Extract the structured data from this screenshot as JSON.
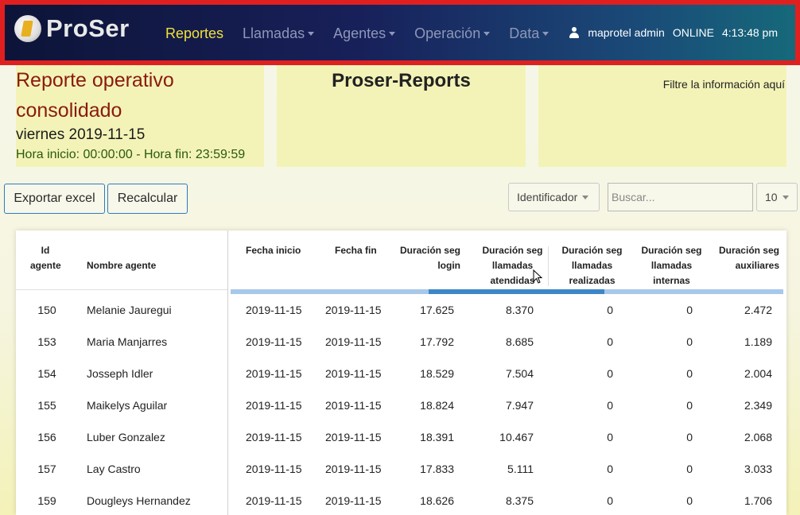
{
  "navbar": {
    "brand": "ProSer",
    "items": [
      {
        "label": "Reportes",
        "active": true,
        "dropdown": false
      },
      {
        "label": "Llamadas",
        "active": false,
        "dropdown": true
      },
      {
        "label": "Agentes",
        "active": false,
        "dropdown": true
      },
      {
        "label": "Operación",
        "active": false,
        "dropdown": true
      },
      {
        "label": "Data",
        "active": false,
        "dropdown": true
      }
    ],
    "user": "maprotel admin",
    "status": "ONLINE",
    "time": "4:13:48 pm"
  },
  "report": {
    "title": "Reporte operativo consolidado",
    "date": "viernes 2019-11-15",
    "hours": "Hora inicio: 00:00:00 - Hora fin: 23:59:59",
    "center_title": "Proser-Reports",
    "filter_hint": "Filtre la información aquí"
  },
  "toolbar": {
    "export_label": "Exportar excel",
    "recalc_label": "Recalcular",
    "field_select": "Identificador",
    "search_placeholder": "Buscar...",
    "page_size": "10"
  },
  "table": {
    "headers": [
      "Id agente",
      "Nombre agente",
      "Fecha inicio",
      "Fecha fin",
      "Duración seg login",
      "Duración seg llamadas atendidas",
      "Duración seg llamadas realizadas",
      "Duración seg llamadas internas",
      "Duración seg auxiliares"
    ],
    "rows": [
      [
        "150",
        "Melanie Jauregui",
        "2019-11-15",
        "2019-11-15",
        "17.625",
        "8.370",
        "0",
        "0",
        "2.472"
      ],
      [
        "153",
        "Maria Manjarres",
        "2019-11-15",
        "2019-11-15",
        "17.792",
        "8.685",
        "0",
        "0",
        "1.189"
      ],
      [
        "154",
        "Josseph Idler",
        "2019-11-15",
        "2019-11-15",
        "18.529",
        "7.504",
        "0",
        "0",
        "2.004"
      ],
      [
        "155",
        "Maikelys Aguilar",
        "2019-11-15",
        "2019-11-15",
        "18.824",
        "7.947",
        "0",
        "0",
        "2.349"
      ],
      [
        "156",
        "Luber Gonzalez",
        "2019-11-15",
        "2019-11-15",
        "18.391",
        "10.467",
        "0",
        "0",
        "2.068"
      ],
      [
        "157",
        "Lay Castro",
        "2019-11-15",
        "2019-11-15",
        "17.833",
        "5.111",
        "0",
        "0",
        "3.033"
      ],
      [
        "159",
        "Dougleys Hernandez",
        "2019-11-15",
        "2019-11-15",
        "18.626",
        "8.375",
        "0",
        "0",
        "1.706"
      ]
    ]
  },
  "colors": {
    "highlight_border": "#e02020",
    "active_nav": "#f0e03a",
    "title_red": "#8b1a0e",
    "panel_bg": "#f3f3b8",
    "button_border": "#2d7bbf"
  }
}
